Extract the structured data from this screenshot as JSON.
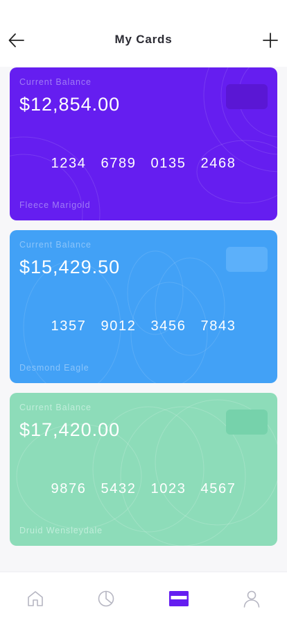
{
  "header": {
    "title": "My Cards",
    "back_icon": "arrow-left-icon",
    "add_icon": "plus-icon"
  },
  "cards": [
    {
      "label": "Current Balance",
      "balance": "$12,854.00",
      "number": [
        "1234",
        "6789",
        "0135",
        "2468"
      ],
      "holder": "Fleece Marigold",
      "color": "#651ef0",
      "label_color": "#a07cf5",
      "chip_color": "#5a17d4"
    },
    {
      "label": "Current Balance",
      "balance": "$15,429.50",
      "number": [
        "1357",
        "9012",
        "3456",
        "7843"
      ],
      "holder": "Desmond Eagle",
      "color": "#42a1f6",
      "label_color": "#8cc5fa",
      "chip_color": "#5cb0fa"
    },
    {
      "label": "Current Balance",
      "balance": "$17,420.00",
      "number": [
        "9876",
        "5432",
        "1023",
        "4567"
      ],
      "holder": "Druid Wensleydale",
      "color": "#8ddcb9",
      "label_color": "#c1eedb",
      "chip_color": "#76d2ab"
    }
  ],
  "nav": {
    "items": [
      "home-icon",
      "pie-chart-icon",
      "credit-card-icon",
      "user-icon"
    ],
    "active_color": "#651ef0",
    "inactive_color": "#b6b6c2"
  }
}
